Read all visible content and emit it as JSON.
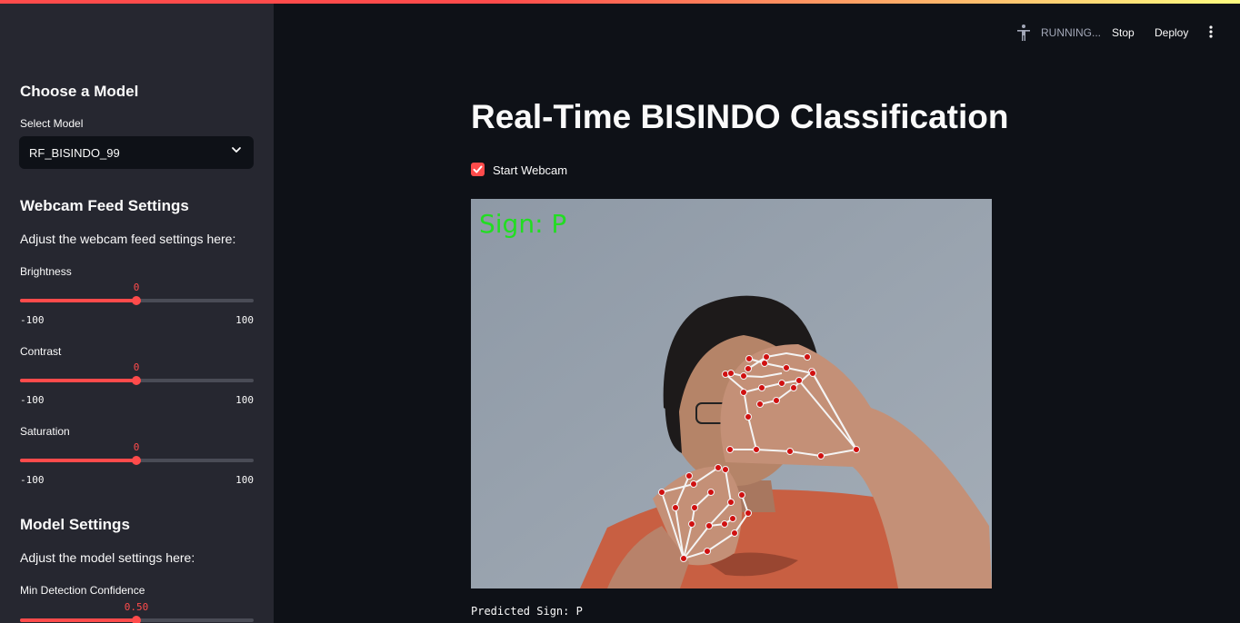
{
  "header": {
    "status": "RUNNING...",
    "stop_label": "Stop",
    "deploy_label": "Deploy"
  },
  "sidebar": {
    "model_heading": "Choose a Model",
    "select_label": "Select Model",
    "selected_model": "RF_BISINDO_99",
    "webcam_heading": "Webcam Feed Settings",
    "webcam_desc": "Adjust the webcam feed settings here:",
    "brightness": {
      "label": "Brightness",
      "value": "0",
      "min": "-100",
      "max": "100",
      "fraction": 0.5
    },
    "contrast": {
      "label": "Contrast",
      "value": "0",
      "min": "-100",
      "max": "100",
      "fraction": 0.5
    },
    "saturation": {
      "label": "Saturation",
      "value": "0",
      "min": "-100",
      "max": "100",
      "fraction": 0.5
    },
    "model_settings_heading": "Model Settings",
    "model_settings_desc": "Adjust the model settings here:",
    "min_detection": {
      "label": "Min Detection Confidence",
      "value": "0.50",
      "fraction": 0.5
    }
  },
  "main": {
    "title": "Real-Time BISINDO Classification",
    "checkbox_label": "Start Webcam",
    "checkbox_checked": true,
    "overlay_text": "Sign: P",
    "predicted": "Predicted Sign: P"
  },
  "colors": {
    "accent": "#ff4b4b",
    "background": "#0e1117",
    "sidebar": "#262730",
    "overlay_text": "#22dd22"
  }
}
